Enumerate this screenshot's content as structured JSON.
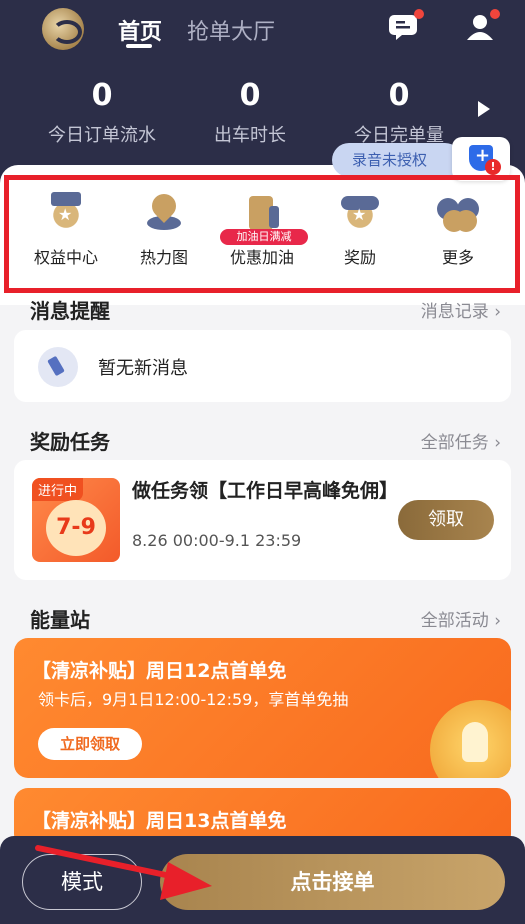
{
  "header": {
    "tabs": [
      {
        "label": "首页",
        "active": true
      },
      {
        "label": "抢单大厅",
        "active": false
      }
    ],
    "icons": [
      "logo",
      "message-icon",
      "profile-icon"
    ],
    "stats": [
      {
        "value": "0",
        "label": "今日订单流水"
      },
      {
        "value": "0",
        "label": "出车时长"
      },
      {
        "value": "0",
        "label": "今日完单量"
      }
    ]
  },
  "recording": {
    "label": "录音未授权"
  },
  "shortcuts": [
    {
      "label": "权益中心",
      "icon": "medal-icon"
    },
    {
      "label": "热力图",
      "icon": "map-pin-icon"
    },
    {
      "label": "优惠加油",
      "icon": "fuel-icon",
      "badge": "加油日满减"
    },
    {
      "label": "奖励",
      "icon": "reward-icon"
    },
    {
      "label": "更多",
      "icon": "more-icon"
    }
  ],
  "messages": {
    "title": "消息提醒",
    "link": "消息记录 ›",
    "empty_text": "暂无新消息"
  },
  "tasks": {
    "title": "奖励任务",
    "link": "全部任务 ›",
    "item": {
      "tag": "进行中",
      "image_text": "7-9",
      "title": "做任务领【工作日早高峰免佣】",
      "date": "8.26 00:00-9.1 23:59",
      "button": "领取"
    }
  },
  "energy": {
    "title": "能量站",
    "link": "全部活动 ›",
    "promos": [
      {
        "title": "【清凉补贴】周日12点首单免",
        "subtitle": "领卡后，9月1日12:00-12:59，享首单免抽",
        "button": "立即领取"
      },
      {
        "title": "【清凉补贴】周日13点首单免"
      }
    ]
  },
  "bottom": {
    "mode_label": "模式",
    "accept_label": "点击接单"
  },
  "colors": {
    "header_bg": "#2c2e48",
    "gold": "#a8844e",
    "orange": "#f86a1e",
    "highlight": "#e8202a"
  }
}
